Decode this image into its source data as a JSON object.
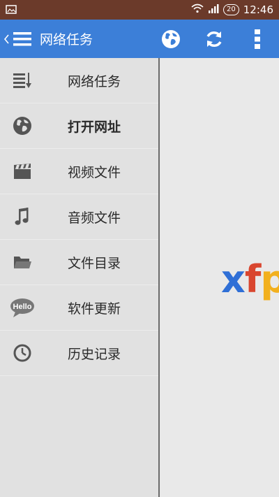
{
  "status_bar": {
    "notification_icon": "image-icon",
    "battery_level": "20",
    "time": "12:46"
  },
  "action_bar": {
    "title": "网络任务",
    "icons": [
      "globe-icon",
      "refresh-icon",
      "more-vert-icon"
    ]
  },
  "drawer": {
    "items": [
      {
        "label": "网络任务",
        "icon": "list-download-icon",
        "bold": false
      },
      {
        "label": "打开网址",
        "icon": "globe-icon",
        "bold": true
      },
      {
        "label": "视频文件",
        "icon": "clapperboard-icon",
        "bold": false
      },
      {
        "label": "音频文件",
        "icon": "music-note-icon",
        "bold": false
      },
      {
        "label": "文件目录",
        "icon": "folder-icon",
        "bold": false
      },
      {
        "label": "软件更新",
        "icon": "hello-bubble-icon",
        "bold": false
      },
      {
        "label": "历史记录",
        "icon": "clock-icon",
        "bold": false
      }
    ],
    "hello_text": "Hello"
  },
  "content": {
    "logo_parts": [
      "x",
      "f",
      "p"
    ],
    "colors": {
      "x": "#2f6fd6",
      "f": "#d9462f",
      "p": "#f2b01e"
    }
  }
}
